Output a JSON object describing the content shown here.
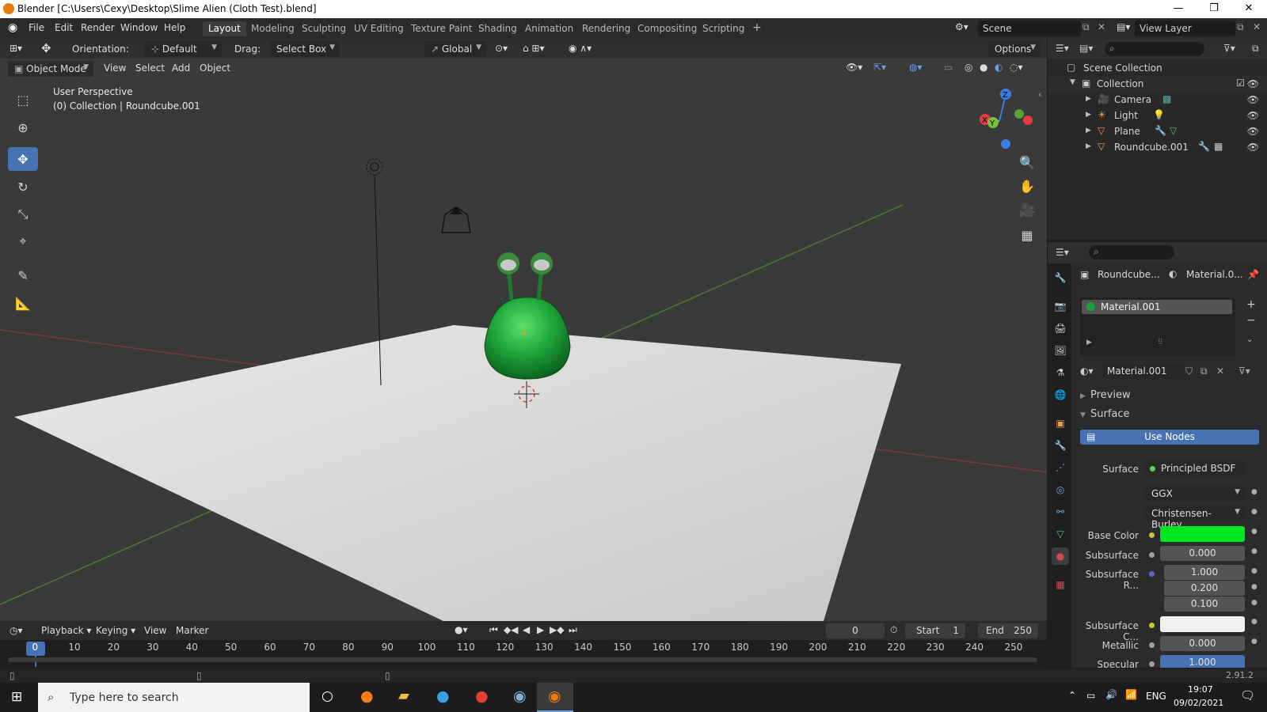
{
  "window": {
    "title": "Blender [C:\\Users\\Cexy\\Desktop\\Slime Alien (Cloth Test).blend]",
    "minimize": "—",
    "maximize": "❐",
    "close": "✕"
  },
  "menu": {
    "items": [
      "File",
      "Edit",
      "Render",
      "Window",
      "Help"
    ],
    "workspaces": [
      "Layout",
      "Modeling",
      "Sculpting",
      "UV Editing",
      "Texture Paint",
      "Shading",
      "Animation",
      "Rendering",
      "Compositing",
      "Scripting"
    ],
    "add_tab": "+",
    "scene": "Scene",
    "view_layer": "View Layer"
  },
  "toolbar": {
    "orientation_label": "Orientation:",
    "orientation_value": "Default",
    "drag_label": "Drag:",
    "drag_value": "Select Box",
    "transform_space": "Global",
    "options": "Options"
  },
  "viewport_header": {
    "mode": "Object Mode",
    "menus": [
      "View",
      "Select",
      "Add",
      "Object"
    ]
  },
  "viewport": {
    "perspective": "User Perspective",
    "collection_info": "(0) Collection | Roundcube.001"
  },
  "outliner": {
    "root": "Scene Collection",
    "collection": "Collection",
    "objects": [
      "Camera",
      "Light",
      "Plane",
      "Roundcube.001"
    ]
  },
  "properties": {
    "object_name": "Roundcube...",
    "material_short": "Material.0...",
    "slot_material": "Material.001",
    "material_name": "Material.001",
    "preview_label": "Preview",
    "surface_section": "Surface",
    "use_nodes": "Use Nodes",
    "surface_label": "Surface",
    "surface_value": "Principled BSDF",
    "distribution": "GGX",
    "subsurface_method": "Christensen-Burley",
    "base_color_label": "Base Color",
    "base_color": "#00e61f",
    "subsurface_label": "Subsurface",
    "subsurface_value": "0.000",
    "subsurface_radius_label": "Subsurface R...",
    "subsurface_radius": [
      "1.000",
      "0.200",
      "0.100"
    ],
    "subsurface_color_label": "Subsurface C...",
    "subsurface_color": "#f0f0f0",
    "metallic_label": "Metallic",
    "metallic_value": "0.000",
    "specular_label": "Specular",
    "specular_value": "1.000"
  },
  "timeline": {
    "menus": [
      "Playback",
      "Keying",
      "View",
      "Marker"
    ],
    "current_frame": "0",
    "start_label": "Start",
    "start": "1",
    "end_label": "End",
    "end": "250",
    "frames": [
      "0",
      "10",
      "20",
      "30",
      "40",
      "50",
      "60",
      "70",
      "80",
      "90",
      "100",
      "110",
      "120",
      "130",
      "140",
      "150",
      "160",
      "170",
      "180",
      "190",
      "200",
      "210",
      "220",
      "230",
      "240",
      "250"
    ]
  },
  "status": {
    "version": "2.91.2"
  },
  "taskbar": {
    "search_placeholder": "Type here to search",
    "language": "ENG",
    "time": "19:07",
    "date": "09/02/2021"
  },
  "colors": {
    "accent": "#4772b3",
    "active_frame": "#4772b3",
    "blender_orange": "#e87d0d",
    "x_axis": "#e04040",
    "y_axis": "#7cc040",
    "z_axis": "#3a7ee0"
  }
}
